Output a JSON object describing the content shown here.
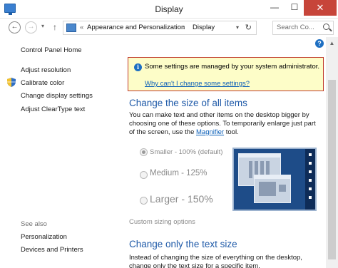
{
  "window": {
    "title": "Display",
    "min_glyph": "—",
    "max_glyph": "☐",
    "close_glyph": "✕"
  },
  "nav": {
    "back_glyph": "←",
    "forward_glyph": "→",
    "dropdown_glyph": "▾",
    "up_glyph": "↑",
    "breadcrumb_prefix": "«",
    "breadcrumb": [
      "Appearance and Personalization",
      "Display"
    ],
    "breadcrumb_sep": "›",
    "address_dropdown_glyph": "▾",
    "refresh_glyph": "↻",
    "search_placeholder": "Search Co..."
  },
  "help_glyph": "?",
  "left_pane": {
    "home_link": "Control Panel Home",
    "links": [
      "Adjust resolution",
      "Calibrate color",
      "Change display settings",
      "Adjust ClearType text"
    ],
    "see_also_heading": "See also",
    "see_also": [
      "Personalization",
      "Devices and Printers"
    ]
  },
  "notice": {
    "icon_glyph": "i",
    "text": "Some settings are managed by your system administrator.",
    "link": "Why can't I change some settings?"
  },
  "section1": {
    "heading": "Change the size of all items",
    "para_before": "You can make text and other items on the desktop bigger by choosing one of these options. To temporarily enlarge just part of the screen, use the ",
    "para_link": "Magnifier",
    "para_after": " tool.",
    "options": [
      {
        "label": "Smaller - 100% (default)",
        "checked": true
      },
      {
        "label": "Medium - 125%",
        "checked": false
      },
      {
        "label": "Larger - 150%",
        "checked": false
      }
    ],
    "custom_sizing": "Custom sizing options"
  },
  "section2": {
    "heading": "Change only the text size",
    "para": "Instead of changing the size of everything on the desktop, change only the text size for a specific item."
  },
  "colors": {
    "accent": "#1f5aa8",
    "link": "#0b5fb8",
    "notice_bg": "#fdfdc8",
    "notice_border": "#c0392b",
    "close_button": "#c7453a"
  }
}
